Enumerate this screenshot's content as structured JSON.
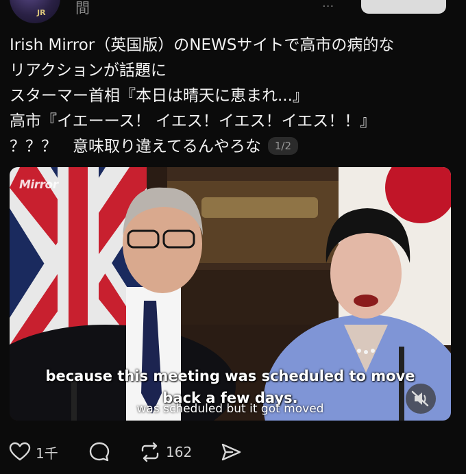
{
  "header": {
    "username_fragment": "間",
    "more_fragment": "..."
  },
  "post": {
    "lines": [
      "Irish Mirror（英国版）のNEWSサイトで高市の病的な",
      "リアクションが話題に",
      "スターマー首相『本日は晴天に恵まれ...』",
      "高市『イエーース！ イエス！イエス！イエス！！』",
      "？？？　意味取り違えてるんやろな"
    ],
    "page_indicator": "1/2"
  },
  "media": {
    "watermark": "Mirror",
    "caption_line1": "because this meeting was scheduled to move",
    "caption_line2": "back a few days.",
    "caption_sub": "was scheduled but it got moved"
  },
  "actions": {
    "like_count": "1千",
    "repost_count": "162"
  },
  "colors": {
    "background": "#0b0b0b",
    "text": "#f2f2f2",
    "muted": "#9a9a9a",
    "follow_button": "#dcdcdc"
  },
  "icons": [
    "heart-icon",
    "comment-icon",
    "repost-icon",
    "share-icon",
    "mute-icon"
  ]
}
